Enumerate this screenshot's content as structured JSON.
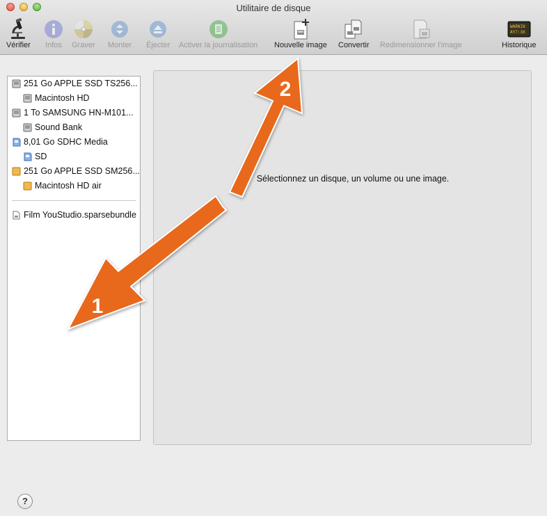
{
  "window": {
    "title": "Utilitaire de disque"
  },
  "toolbar": {
    "verify": "Vérifier",
    "info": "Infos",
    "burn": "Graver",
    "mount": "Monter",
    "eject": "Éjecter",
    "journal": "Activer la journalisation",
    "new_image": "Nouvelle image",
    "convert": "Convertir",
    "resize": "Redimensionner l'image",
    "log": "Historique",
    "log_icon_text_1": "WARNIN",
    "log_icon_text_2": "AY7:36"
  },
  "sidebar": {
    "items": [
      {
        "label": "251 Go APPLE SSD TS256..."
      },
      {
        "label": "Macintosh HD"
      },
      {
        "label": "1 To SAMSUNG HN-M101..."
      },
      {
        "label": "Sound Bank"
      },
      {
        "label": "8,01 Go SDHC Media"
      },
      {
        "label": "SD"
      },
      {
        "label": "251 Go APPLE SSD SM256..."
      },
      {
        "label": "Macintosh HD air"
      },
      {
        "label": "Film YouStudio.sparsebundle"
      }
    ]
  },
  "main": {
    "message": "Sélectionnez un disque, un volume ou une image."
  },
  "help": {
    "label": "?"
  },
  "annotations": {
    "arrow1_label": "1",
    "arrow2_label": "2",
    "color": "#e8671c"
  }
}
